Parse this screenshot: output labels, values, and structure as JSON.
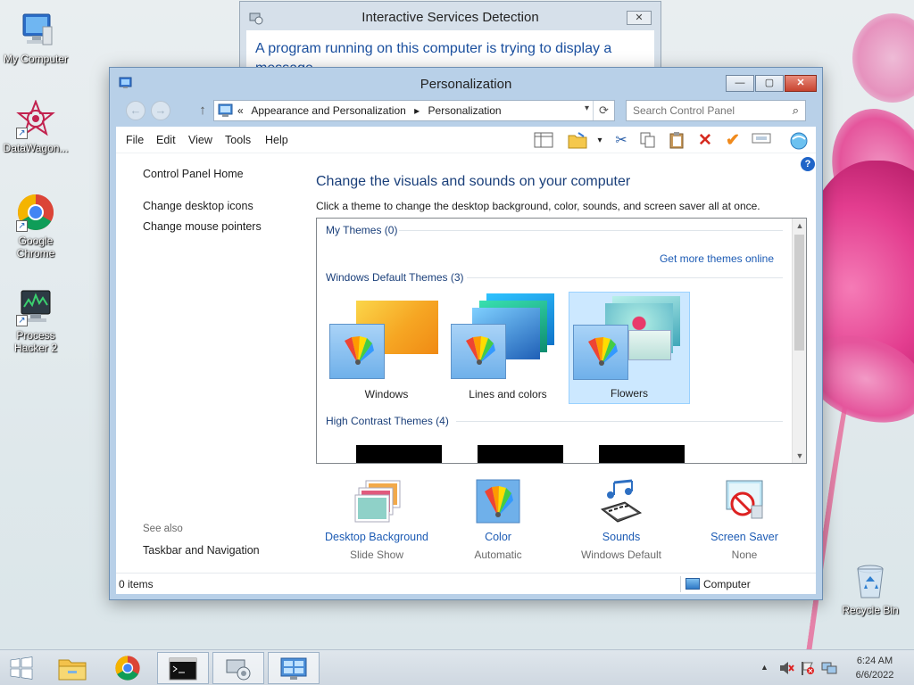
{
  "desktop": {
    "icons": [
      {
        "label": "My Computer"
      },
      {
        "label": "DataWagon..."
      },
      {
        "label": "Google Chrome"
      },
      {
        "label": "Process Hacker 2"
      },
      {
        "label": "Recycle Bin"
      }
    ]
  },
  "dialog": {
    "title": "Interactive Services Detection",
    "close_label": "✕",
    "message": "A program running on this computer is trying to display a message"
  },
  "window": {
    "title": "Personalization",
    "min_label": "—",
    "max_label": "▢",
    "close_label": "✕",
    "breadcrumb": [
      "«",
      "Appearance and Personalization",
      "▸",
      "Personalization"
    ],
    "search_placeholder": "Search Control Panel",
    "menu": [
      "File",
      "Edit",
      "View",
      "Tools",
      "Help"
    ],
    "help_label": "?",
    "left_nav": {
      "home": "Control Panel Home",
      "links": [
        "Change desktop icons",
        "Change mouse pointers"
      ],
      "see_also_label": "See also",
      "see_also_links": [
        "Taskbar and Navigation"
      ]
    },
    "main": {
      "title": "Change the visuals and sounds on your computer",
      "description": "Click a theme to change the desktop background, color, sounds, and screen saver all at once.",
      "groups": {
        "my_themes": "My Themes (0)",
        "get_more": "Get more themes online",
        "default_themes": "Windows Default Themes (3)",
        "high_contrast": "High Contrast Themes (4)"
      },
      "themes": [
        {
          "label": "Windows",
          "selected": false
        },
        {
          "label": "Lines and colors",
          "selected": false
        },
        {
          "label": "Flowers",
          "selected": true
        }
      ]
    },
    "bottom": [
      {
        "title": "Desktop Background",
        "subtitle": "Slide Show",
        "icon": "desktop-background-icon"
      },
      {
        "title": "Color",
        "subtitle": "Automatic",
        "icon": "color-icon"
      },
      {
        "title": "Sounds",
        "subtitle": "Windows Default",
        "icon": "sounds-icon"
      },
      {
        "title": "Screen Saver",
        "subtitle": "None",
        "icon": "screen-saver-icon"
      }
    ],
    "status": {
      "items": "0 items",
      "location": "Computer"
    }
  },
  "taskbar": {
    "clock_time": "6:24 AM",
    "clock_date": "6/6/2022",
    "tray_arrow": "▲"
  },
  "colors": {
    "accent_link": "#1c5bb4",
    "heading": "#1a3f7a",
    "selection": "#cce8ff"
  }
}
